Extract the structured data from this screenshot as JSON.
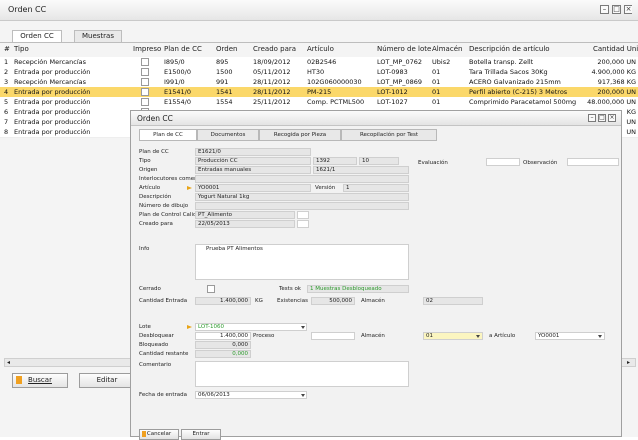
{
  "main": {
    "title": "Orden CC",
    "tabs": [
      "Orden CC",
      "Muestras"
    ],
    "columns": {
      "num": "#",
      "tipo": "Tipo",
      "impreso": "Impreso",
      "plan": "Plan de CC",
      "orden": "Orden",
      "creado": "Creado para",
      "articulo": "Artículo",
      "lote": "Número de lote",
      "almacen": "Almacén",
      "desc": "Descripción de artículo",
      "cantidad": "Cantidad Unid"
    },
    "rows": [
      {
        "num": "1",
        "tipo": "Recepción Mercancías",
        "plan": "I895/0",
        "orden": "895",
        "creado": "18/09/2012",
        "articulo": "02B2546",
        "lote": "LOT_MP_0762",
        "almacen": "Ubis2",
        "desc": "Botella transp. Zellt",
        "cantidad": "200,000 UN"
      },
      {
        "num": "2",
        "tipo": "Entrada por producción",
        "plan": "E1500/0",
        "orden": "1500",
        "creado": "05/11/2012",
        "articulo": "HT30",
        "lote": "LOT-0983",
        "almacen": "01",
        "desc": "Tara Trillada Sacos 30Kg",
        "cantidad": "4.900,000 KG"
      },
      {
        "num": "3",
        "tipo": "Recepción Mercancías",
        "plan": "I991/0",
        "orden": "991",
        "creado": "28/11/2012",
        "articulo": "102G060000030",
        "lote": "LOT_MP_0869",
        "almacen": "01",
        "desc": "ACERO Galvanizado 215mm",
        "cantidad": "917,368 KG"
      },
      {
        "num": "4",
        "tipo": "Entrada por producción",
        "plan": "E1541/0",
        "orden": "1541",
        "creado": "28/11/2012",
        "articulo": "PM-215",
        "lote": "LOT-1012",
        "almacen": "01",
        "desc": "Perfil abierto (C-215) 3 Metros",
        "cantidad": "200,000 UN"
      },
      {
        "num": "5",
        "tipo": "Entrada por producción",
        "plan": "E1554/0",
        "orden": "1554",
        "creado": "25/11/2012",
        "articulo": "Comp. PCTML500",
        "lote": "LOT-1027",
        "almacen": "01",
        "desc": "Comprimido Paracetamol 500mg",
        "cantidad": "48.000,000 UN"
      },
      {
        "num": "6",
        "tipo": "Entrada por producción",
        "plan": "",
        "orden": "",
        "creado": "",
        "articulo": "",
        "lote": "",
        "almacen": "",
        "desc": "",
        "cantidad": "KG"
      },
      {
        "num": "7",
        "tipo": "Entrada por producción",
        "plan": "",
        "orden": "",
        "creado": "",
        "articulo": "",
        "lote": "",
        "almacen": "",
        "desc": "",
        "cantidad": "UN"
      },
      {
        "num": "8",
        "tipo": "Entrada por producción",
        "plan": "",
        "orden": "",
        "creado": "",
        "articulo": "",
        "lote": "",
        "almacen": "",
        "desc": "",
        "cantidad": "UN"
      }
    ],
    "buttons": {
      "buscar": "Buscar",
      "editar": "Editar"
    }
  },
  "dialog": {
    "title": "Orden CC",
    "tabs": [
      "Plan de CC",
      "Documentos",
      "Recogida por Pieza",
      "Recopilación por Test"
    ],
    "labels": {
      "plan": "Plan de CC",
      "tipo": "Tipo",
      "origen": "Origen",
      "interlocutores": "Interlocutores comerci.",
      "articulo": "Artículo",
      "descripcion": "Descripción",
      "dibujo": "Número de dibujo",
      "plan_calidad": "Plan de Control Calid...",
      "creado": "Creado para",
      "info": "Info",
      "evaluacion": "Evaluación",
      "observacion": "Observación",
      "version": "Versión",
      "cerrado": "Cerrado",
      "tests_ok": "Tests ok",
      "cantidad_entrada": "Cantidad Entrada",
      "existencias": "Existencias",
      "almacen": "Almacén",
      "lote": "Lote",
      "desbloquear": "Desbloquear",
      "proceso": "Proceso",
      "almacen2": "Almacén",
      "a_articulo": "a Artículo",
      "bloqueado": "Bloqueado",
      "cantidad_restante": "Cantidad restante",
      "comentario": "Comentario",
      "fecha_entrada": "Fecha de entrada"
    },
    "values": {
      "plan": "E1621/0",
      "tipo": "Producción CC",
      "tipo_num": "1392",
      "tipo_num2": "10",
      "origen": "Entradas manuales",
      "origen_num": "1621/1",
      "articulo": "YO0001",
      "version": "1",
      "descripcion": "Yogurt Natural 1kg",
      "plan_calidad": "PT_Alimento",
      "creado": "22/05/2013",
      "info": "Prueba PT Alimentos",
      "tests_ok": "1 Muestras Desbloqueado",
      "cantidad_entrada": "1.400,000",
      "unidad": "KG",
      "existencias": "500,000",
      "almacen": "02",
      "lote": "LOT-1060",
      "desbloquear": "1.400,000",
      "almacen2": "01",
      "a_articulo": "YO0001",
      "bloqueado": "0,000",
      "cantidad_restante": "0,000",
      "fecha_entrada": "06/06/2013"
    },
    "buttons": {
      "cancelar": "Cancelar",
      "entrar": "Entrar"
    }
  }
}
